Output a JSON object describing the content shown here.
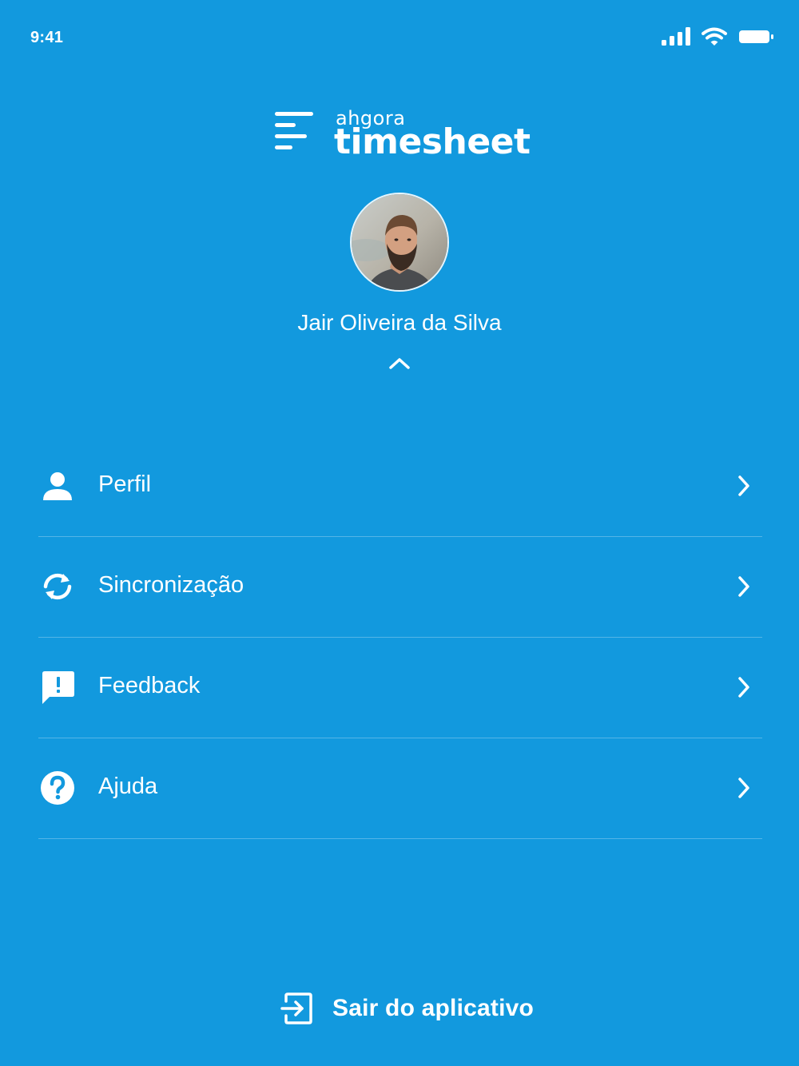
{
  "status_bar": {
    "time": "9:41"
  },
  "logo": {
    "brand": "ahgora",
    "product": "timesheet"
  },
  "user": {
    "name": "Jair Oliveira da Silva"
  },
  "menu": {
    "items": [
      {
        "label": "Perfil",
        "icon": "person-icon"
      },
      {
        "label": "Sincronização",
        "icon": "sync-icon"
      },
      {
        "label": "Feedback",
        "icon": "feedback-icon"
      },
      {
        "label": "Ajuda",
        "icon": "help-icon"
      }
    ]
  },
  "logout": {
    "label": "Sair do aplicativo",
    "icon": "exit-icon"
  },
  "colors": {
    "background": "#1299de",
    "foreground": "#ffffff"
  }
}
